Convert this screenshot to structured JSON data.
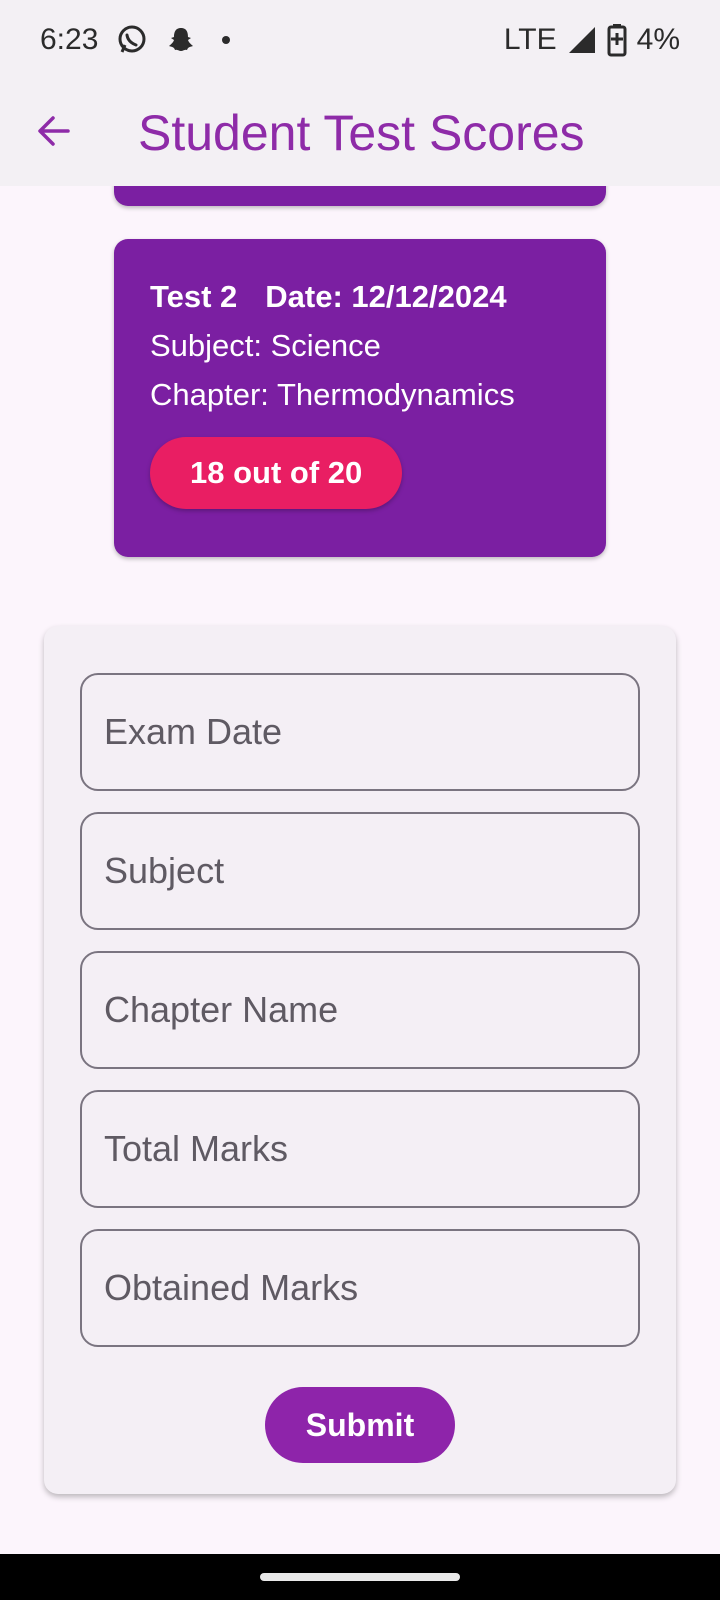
{
  "status_bar": {
    "time": "6:23",
    "network": "LTE",
    "battery": "4%",
    "icons": [
      "whatsapp-icon",
      "snapchat-icon",
      "notification-dot-icon",
      "signal-icon",
      "battery-icon"
    ]
  },
  "app_bar": {
    "title": "Student Test Scores",
    "back_icon": "arrow-back-icon",
    "accent_color": "#8e2ba8"
  },
  "scores": [
    {
      "test": "Test 2",
      "date": "Date: 12/12/2024",
      "subject": "Subject: Science",
      "chapter": "Chapter: Thermodynamics",
      "score": "18 out of 20"
    }
  ],
  "form": {
    "exam_date_placeholder": "Exam Date",
    "subject_placeholder": "Subject",
    "chapter_placeholder": "Chapter Name",
    "total_marks_placeholder": "Total Marks",
    "obtained_marks_placeholder": "Obtained Marks",
    "submit_label": "Submit"
  },
  "colors": {
    "card": "#7b1fa2",
    "score_pill": "#e91e63",
    "submit": "#8e24aa"
  }
}
